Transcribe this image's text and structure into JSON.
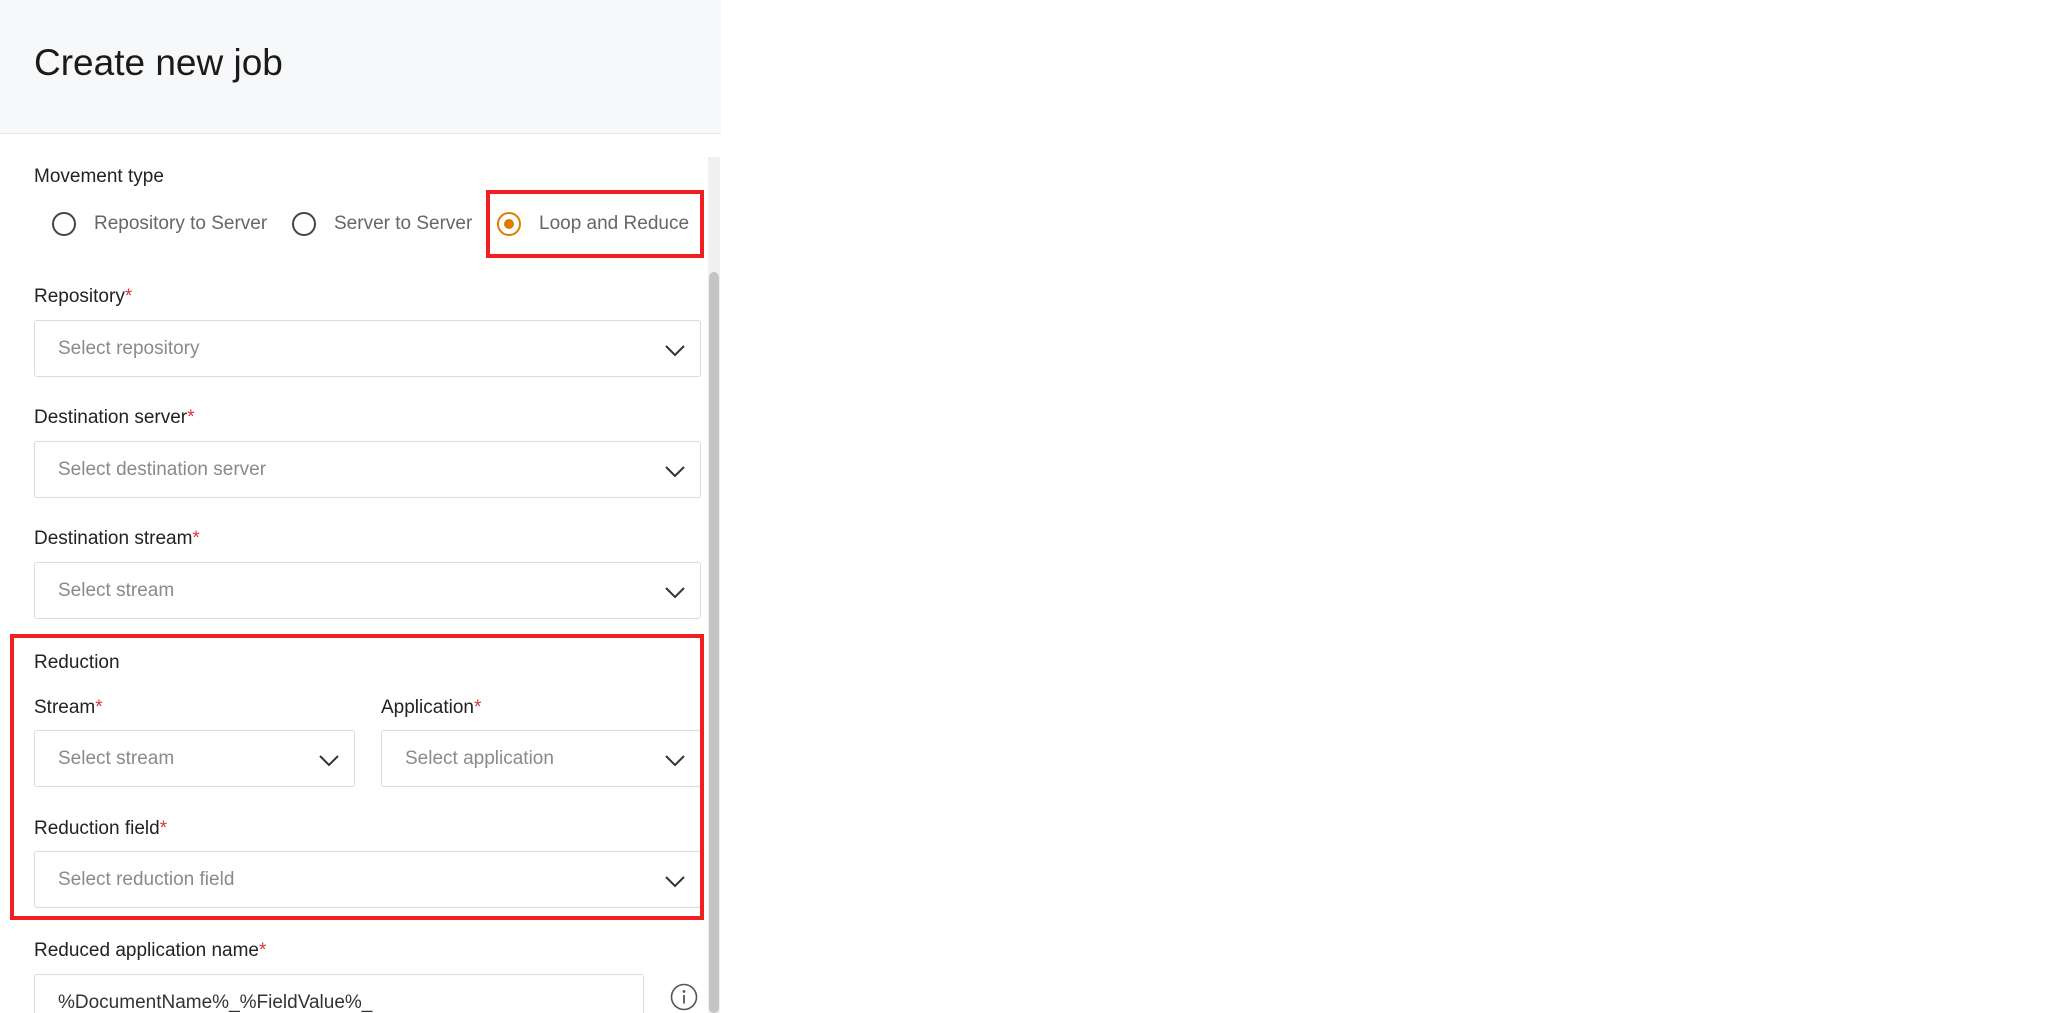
{
  "page": {
    "title": "Create new job"
  },
  "movement": {
    "label": "Movement type",
    "options": [
      {
        "label": "Repository to Server",
        "selected": false
      },
      {
        "label": "Server to Server",
        "selected": false
      },
      {
        "label": "Loop and Reduce",
        "selected": true
      }
    ]
  },
  "repository": {
    "label": "Repository",
    "placeholder": "Select repository"
  },
  "destination_server": {
    "label": "Destination server",
    "placeholder": "Select destination server"
  },
  "destination_stream": {
    "label": "Destination stream",
    "placeholder": "Select stream"
  },
  "reduction": {
    "section_label": "Reduction",
    "stream": {
      "label": "Stream",
      "placeholder": "Select stream"
    },
    "application": {
      "label": "Application",
      "placeholder": "Select application"
    },
    "field": {
      "label": "Reduction field",
      "placeholder": "Select reduction field"
    }
  },
  "reduced_app_name": {
    "label": "Reduced application name",
    "value": "%DocumentName%_%FieldValue%_"
  },
  "required_marker": "*",
  "colors": {
    "accent": "#e07b00",
    "highlight": "#f02020",
    "required": "#d9363e"
  },
  "icons": {
    "dropdown": "chevron-down-icon",
    "info": "info-icon"
  }
}
